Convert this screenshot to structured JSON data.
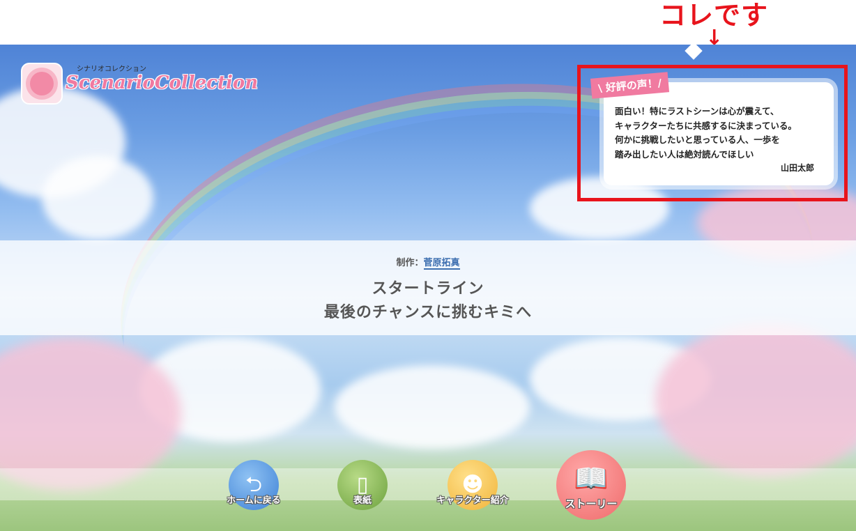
{
  "annotation": {
    "label": "コレです",
    "arrow": "↓"
  },
  "logo": {
    "subtitle": "シナリオコレクション",
    "title": "ScenarioCollection"
  },
  "review": {
    "tag": "\\ 好評の声！/",
    "lines": [
      "面白い！特にラストシーンは心が震えて、",
      "キャラクターたちに共感するに決まっている。",
      "何かに挑戦したいと思っている人、一歩を",
      "踏み出したい人は絶対読んでほしい"
    ],
    "author": "山田太郎"
  },
  "credit": {
    "label": "制作：",
    "author": "菅原拓真"
  },
  "title": {
    "line1": "スタートライン",
    "line2": "最後のチャンスに挑むキミへ"
  },
  "nav": {
    "home": "ホームに戻る",
    "cover": "表紙",
    "characters": "キャラクター紹介",
    "story": "ストーリー"
  },
  "colors": {
    "annotation_red": "#e8141c",
    "accent_pink": "#f07aa0",
    "link_blue": "#3d6fb0"
  }
}
